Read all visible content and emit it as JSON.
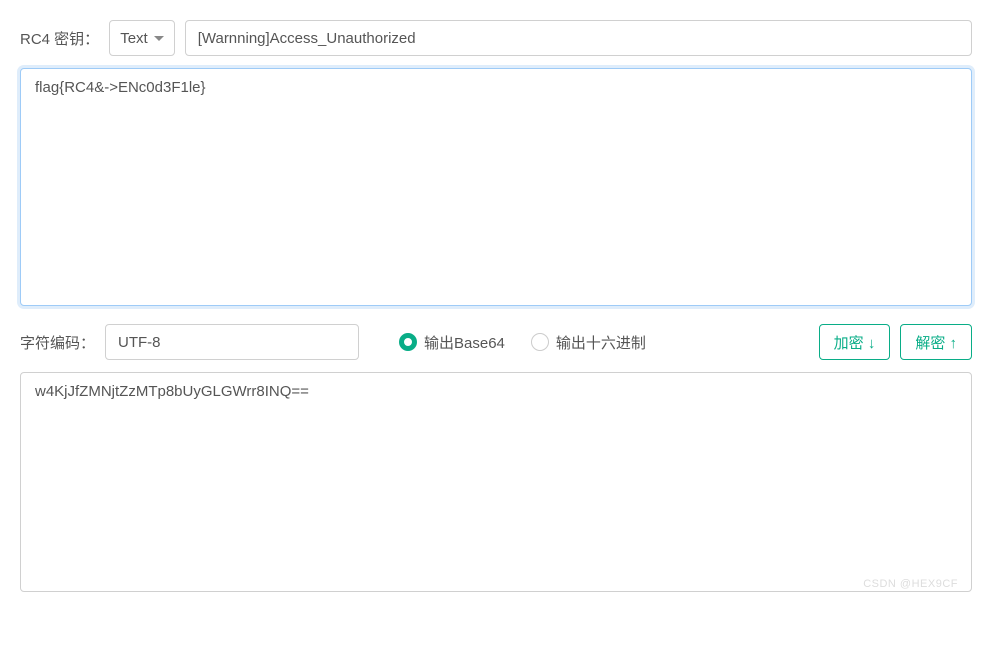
{
  "key_row": {
    "label": "RC4 密钥：",
    "format_selected": "Text",
    "key_value": "[Warnning]Access_Unauthorized"
  },
  "input_area": {
    "value": "flag{RC4&->ENc0d3F1le}"
  },
  "encoding_row": {
    "label": "字符编码：",
    "encoding_selected": "UTF-8",
    "radio_base64": "输出Base64",
    "radio_hex": "输出十六进制",
    "encrypt_btn": "加密 ↓",
    "decrypt_btn": "解密 ↑"
  },
  "output_area": {
    "value": "w4KjJfZMNjtZzMTp8bUyGLGWrr8INQ=="
  },
  "watermark": "CSDN @HEX9CF"
}
